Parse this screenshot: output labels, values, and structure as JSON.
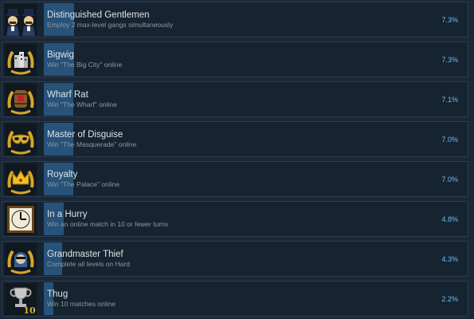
{
  "achievements": [
    {
      "title": "Distinguished Gentlemen",
      "description": "Employ 2 max-level gangs simultaneously",
      "percent_label": "7.3%",
      "percent": 7.3,
      "icon": "gentlemen-icon"
    },
    {
      "title": "Bigwig",
      "description": "Win \"The Big City\" online",
      "percent_label": "7.3%",
      "percent": 7.3,
      "icon": "city-emblem-icon"
    },
    {
      "title": "Wharf Rat",
      "description": "Win \"The Wharf\" online",
      "percent_label": "7.1%",
      "percent": 7.1,
      "icon": "barrel-emblem-icon"
    },
    {
      "title": "Master of Disguise",
      "description": "Win \"The Masquerade\" online",
      "percent_label": "7.0%",
      "percent": 7.0,
      "icon": "mask-emblem-icon"
    },
    {
      "title": "Royalty",
      "description": "Win \"The Palace\" online",
      "percent_label": "7.0%",
      "percent": 7.0,
      "icon": "crown-emblem-icon"
    },
    {
      "title": "In a Hurry",
      "description": "Win an online match in 10 or fewer turns",
      "percent_label": "4.8%",
      "percent": 4.8,
      "icon": "clock-icon"
    },
    {
      "title": "Grandmaster Thief",
      "description": "Complete all levels on Hard",
      "percent_label": "4.3%",
      "percent": 4.3,
      "icon": "thief-emblem-icon"
    },
    {
      "title": "Thug",
      "description": "Win 10 matches online",
      "percent_label": "2.2%",
      "percent": 2.2,
      "icon": "trophy-10-icon"
    }
  ],
  "colors": {
    "background": "#1b2838",
    "row": "#162330",
    "bar": "#2a5a86",
    "percent_text": "#66c0f4",
    "emblem_gold": "#d4a62a"
  }
}
